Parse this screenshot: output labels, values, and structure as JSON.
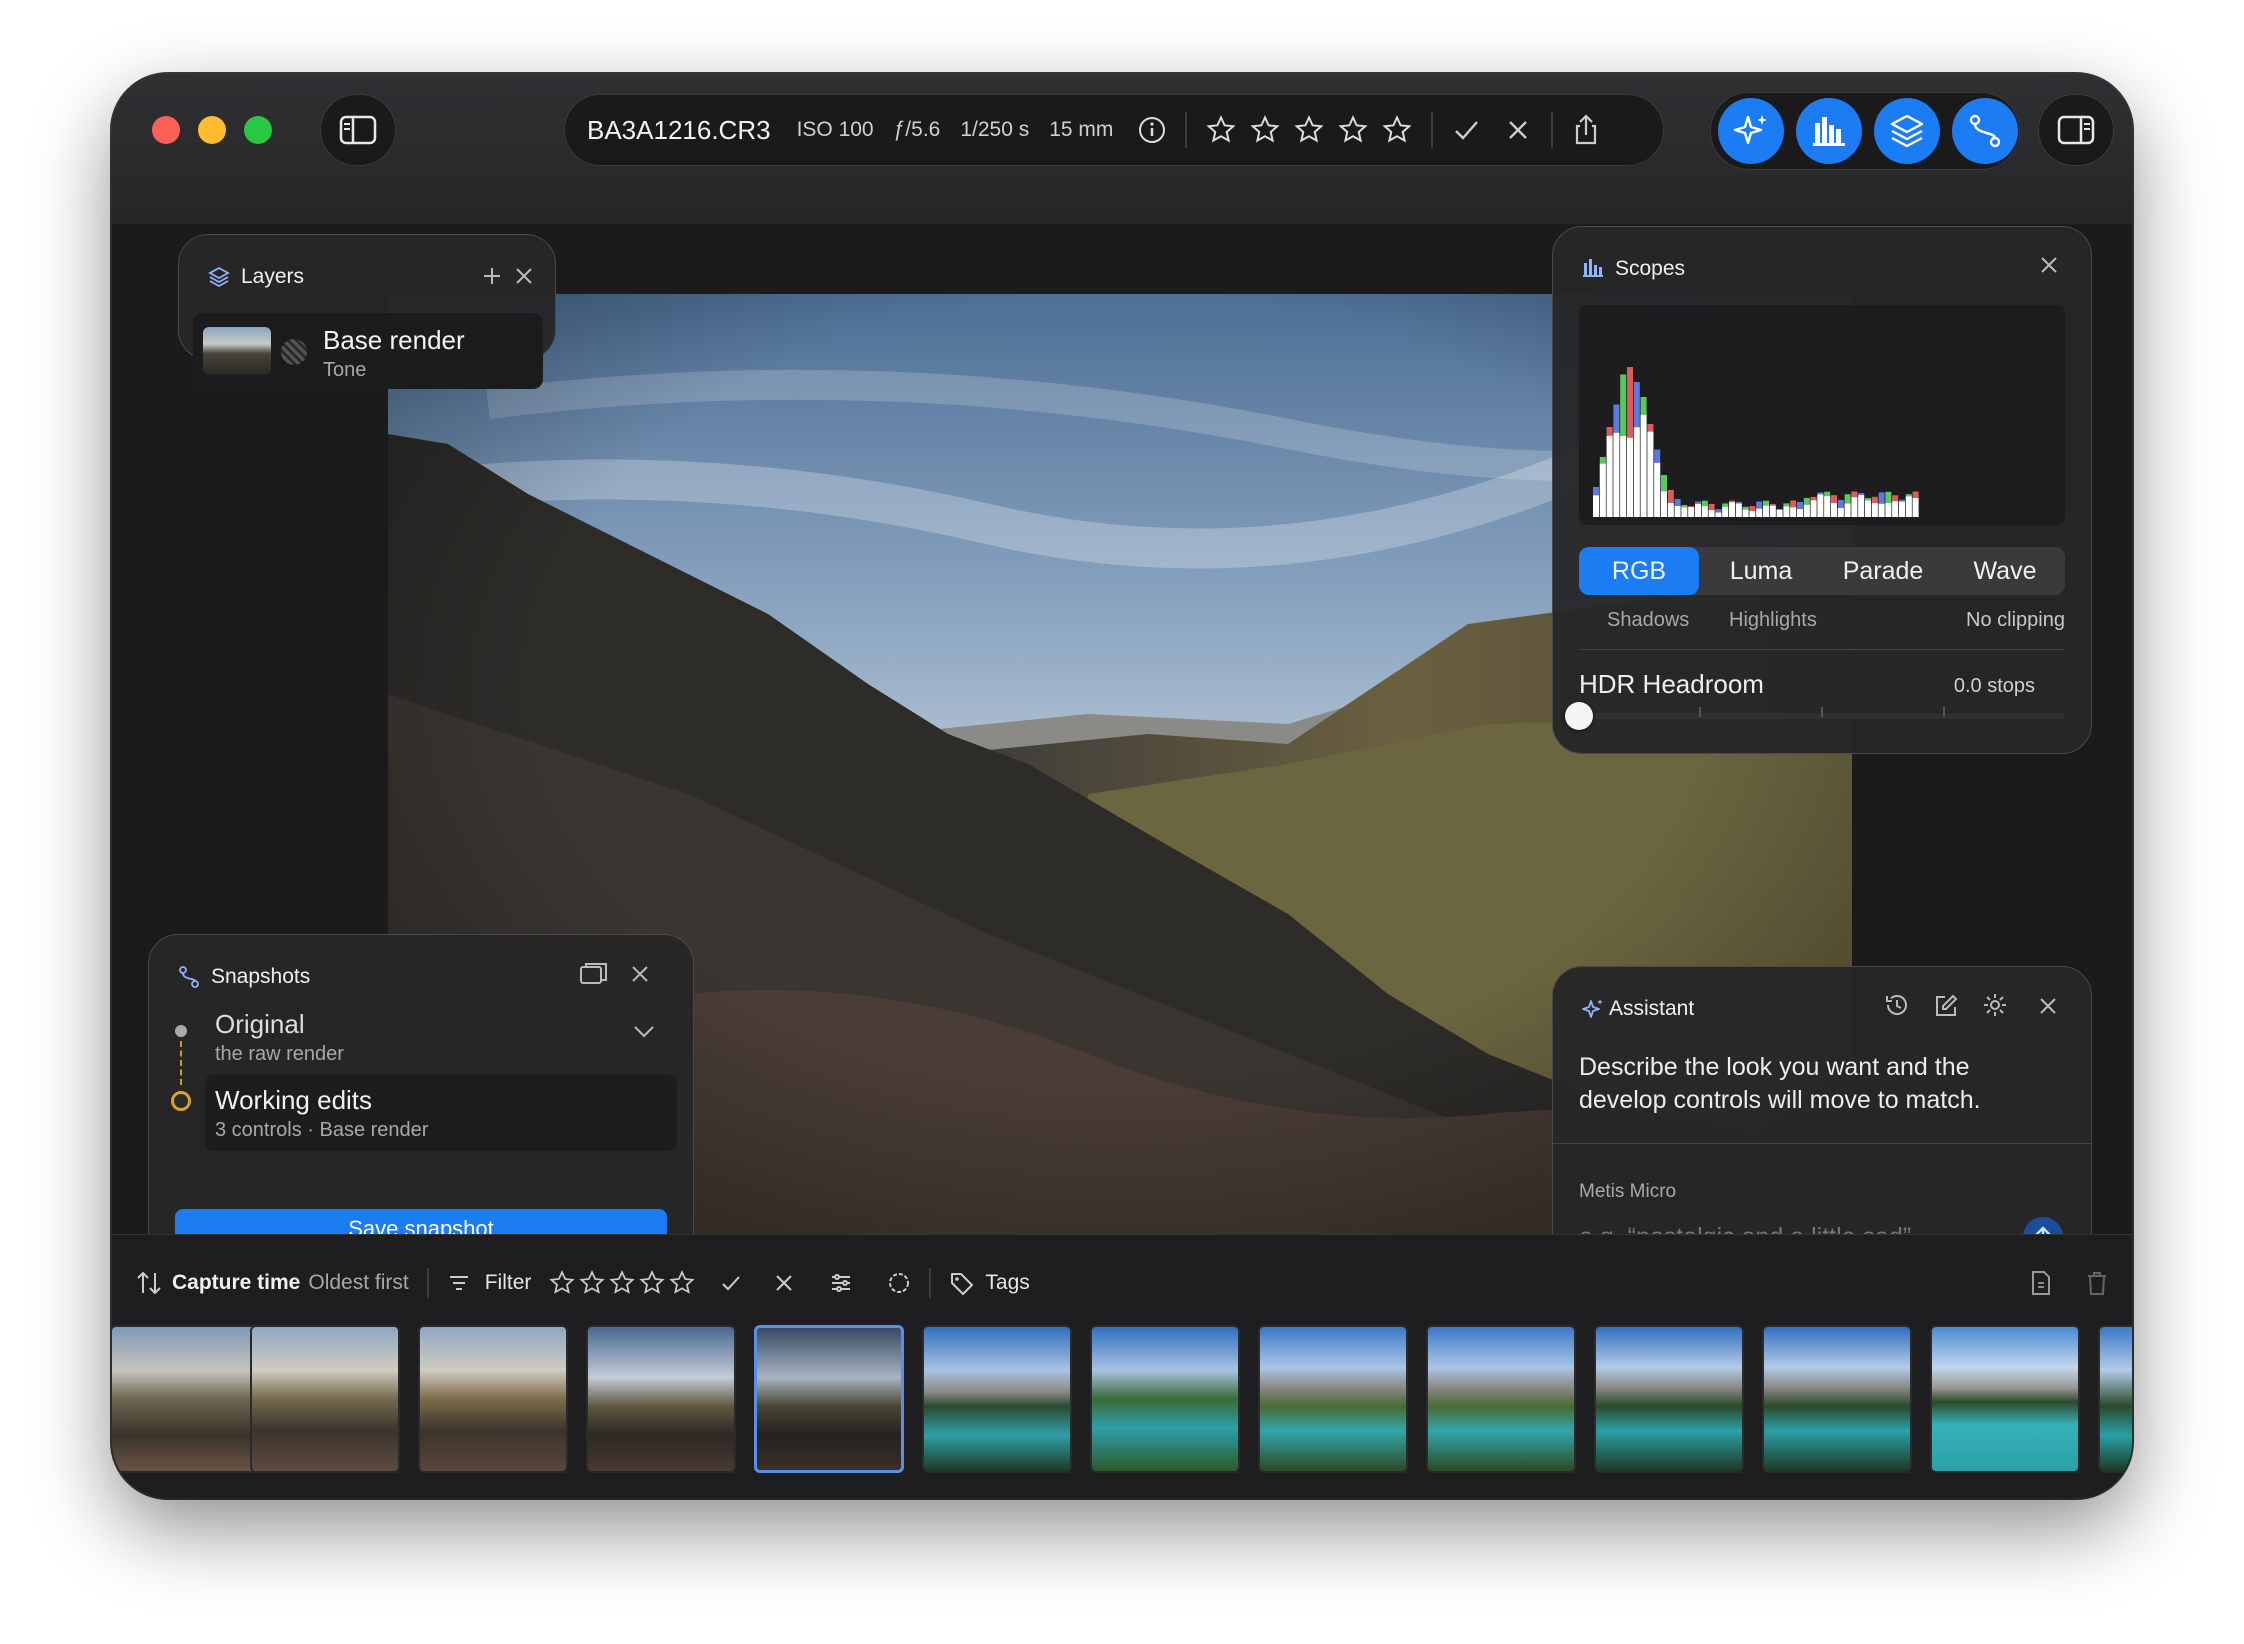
{
  "titlebar": {
    "filename": "BA3A1216.CR3",
    "iso": "ISO 100",
    "aperture": "ƒ/5.6",
    "shutter": "1/250 s",
    "focal": "15 mm"
  },
  "layers": {
    "title": "Layers",
    "item_title": "Base render",
    "item_sub": "Tone"
  },
  "scopes": {
    "title": "Scopes",
    "tabs": [
      "RGB",
      "Luma",
      "Parade",
      "Wave"
    ],
    "active_tab": "RGB",
    "shadows": "Shadows",
    "highlights": "Highlights",
    "clipping": "No clipping",
    "hdr_label": "HDR Headroom",
    "hdr_value": "0.0 stops",
    "hdr_level": 0
  },
  "snapshots": {
    "title": "Snapshots",
    "items": [
      {
        "title": "Original",
        "sub": "the raw render"
      },
      {
        "title": "Working edits",
        "sub": "3 controls · Base render"
      }
    ],
    "save_label": "Save snapshot"
  },
  "assistant": {
    "title": "Assistant",
    "prompt": "Describe the look you want and the develop controls will move to match.",
    "model": "Metis Micro",
    "placeholder": "e.g. “nostalgic and a little sad”"
  },
  "filmstrip": {
    "sort_label": "Capture time",
    "sort_order": "Oldest first",
    "filter_label": "Filter",
    "tags_label": "Tags"
  },
  "colors": {
    "accent": "#1c7cf4",
    "histogram_red": "#e05a5a",
    "histogram_green": "#5ac85a",
    "histogram_blue": "#5a7ae0"
  }
}
